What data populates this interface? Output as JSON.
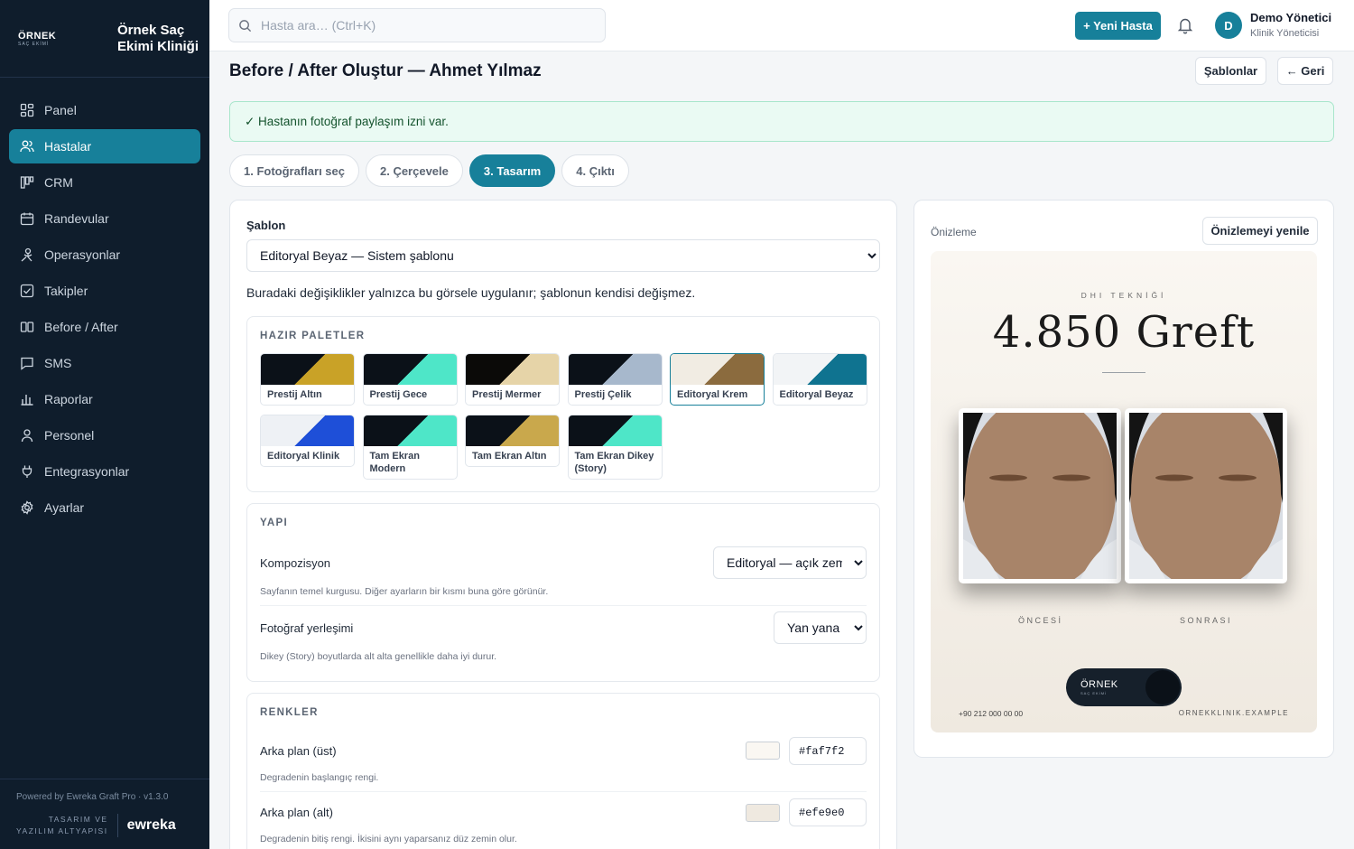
{
  "sidebar": {
    "logo_line1": "ÖRNEK",
    "logo_line2": "SAÇ EKİMİ",
    "clinic_name": "Örnek Saç Ekimi Kliniği",
    "items": [
      {
        "label": "Panel",
        "icon": "grid-icon"
      },
      {
        "label": "Hastalar",
        "icon": "users-icon",
        "active": true
      },
      {
        "label": "CRM",
        "icon": "kanban-icon"
      },
      {
        "label": "Randevular",
        "icon": "calendar-icon"
      },
      {
        "label": "Operasyonlar",
        "icon": "scalpel-icon"
      },
      {
        "label": "Takipler",
        "icon": "checklist-icon"
      },
      {
        "label": "Before / After",
        "icon": "split-icon"
      },
      {
        "label": "SMS",
        "icon": "message-icon"
      },
      {
        "label": "Raporlar",
        "icon": "bar-chart-icon"
      },
      {
        "label": "Personel",
        "icon": "person-icon"
      },
      {
        "label": "Entegrasyonlar",
        "icon": "plug-icon"
      },
      {
        "label": "Ayarlar",
        "icon": "gear-icon"
      }
    ],
    "powered": "Powered by Ewreka Graft Pro · v1.3.0",
    "footer_caption_1": "TASARIM VE",
    "footer_caption_2": "YAZILIM ALTYAPISI",
    "footer_logo": "ewreka"
  },
  "topbar": {
    "search_placeholder": "Hasta ara… (Ctrl+K)",
    "new_patient": "+ Yeni Hasta",
    "avatar_initial": "D",
    "user_name": "Demo Yönetici",
    "user_role": "Klinik Yöneticisi"
  },
  "page": {
    "title": "Before / After Oluştur — Ahmet Yılmaz",
    "templates_button": "Şablonlar",
    "back_button": "← Geri",
    "consent_alert": "✓ Hastanın fotoğraf paylaşım izni var.",
    "steps": [
      "1. Fotoğrafları seç",
      "2. Çerçevele",
      "3. Tasarım",
      "4. Çıktı"
    ],
    "active_step": 3
  },
  "design": {
    "template_label": "Şablon",
    "template_selected": "Editoryal Beyaz — Sistem şablonu",
    "template_note": "Buradaki değişiklikler yalnızca bu görsele uygulanır; şablonun kendisi değişmez.",
    "palettes_title": "HAZIR PALETLER",
    "palettes": [
      {
        "name": "Prestij Altın",
        "dark": "#0b1118",
        "accent": "#c9a227"
      },
      {
        "name": "Prestij Gece",
        "dark": "#0b1118",
        "accent": "#4ee6c8"
      },
      {
        "name": "Prestij Mermer",
        "dark": "#0b0a08",
        "accent": "#e6d4a8"
      },
      {
        "name": "Prestij Çelik",
        "dark": "#0b1118",
        "accent": "#a7b8cc"
      },
      {
        "name": "Editoryal Krem",
        "dark": "#f1ece3",
        "accent": "#8b6b3e",
        "selected": true
      },
      {
        "name": "Editoryal Beyaz",
        "dark": "#f2f4f6",
        "accent": "#0f7390"
      },
      {
        "name": "Editoryal Klinik",
        "dark": "#eef1f5",
        "accent": "#1e4fd8"
      },
      {
        "name": "Tam Ekran Modern",
        "dark": "#0b1118",
        "accent": "#4ee6c8"
      },
      {
        "name": "Tam Ekran Altın",
        "dark": "#0b1118",
        "accent": "#c9a84c"
      },
      {
        "name": "Tam Ekran Dikey (Story)",
        "dark": "#0b1118",
        "accent": "#4ee6c8"
      }
    ],
    "structure_title": "YAPI",
    "composition_label": "Kompozisyon",
    "composition_value": "Editoryal — açık zemin",
    "composition_help": "Sayfanın temel kurgusu. Diğer ayarların bir kısmı buna göre görünür.",
    "photo_layout_label": "Fotoğraf yerleşimi",
    "photo_layout_value": "Yan yana",
    "photo_layout_help": "Dikey (Story) boyutlarda alt alta genellikle daha iyi durur.",
    "colors_title": "RENKLER",
    "bg_top_label": "Arka plan (üst)",
    "bg_top_value": "#faf7f2",
    "bg_top_help": "Degradenin başlangıç rengi.",
    "bg_bottom_label": "Arka plan (alt)",
    "bg_bottom_value": "#efe9e0",
    "bg_bottom_help": "Degradenin bitiş rengi. İkisini aynı yaparsanız düz zemin olur."
  },
  "preview": {
    "title": "Önizleme",
    "refresh_button": "Önizlemeyi yenile",
    "kicker": "DHI TEKNİĞİ",
    "headline": "4.850 Greft",
    "before_caption": "ÖNCESİ",
    "after_caption": "SONRASI",
    "logo_line1": "ÖRNEK",
    "logo_line2": "SAÇ EKİMİ",
    "phone": "+90 212 000 00 00",
    "website": "ORNEKKLINIK.EXAMPLE"
  },
  "colors": {
    "accent": "#17809a",
    "sidebar_bg": "#0f1d2c"
  }
}
